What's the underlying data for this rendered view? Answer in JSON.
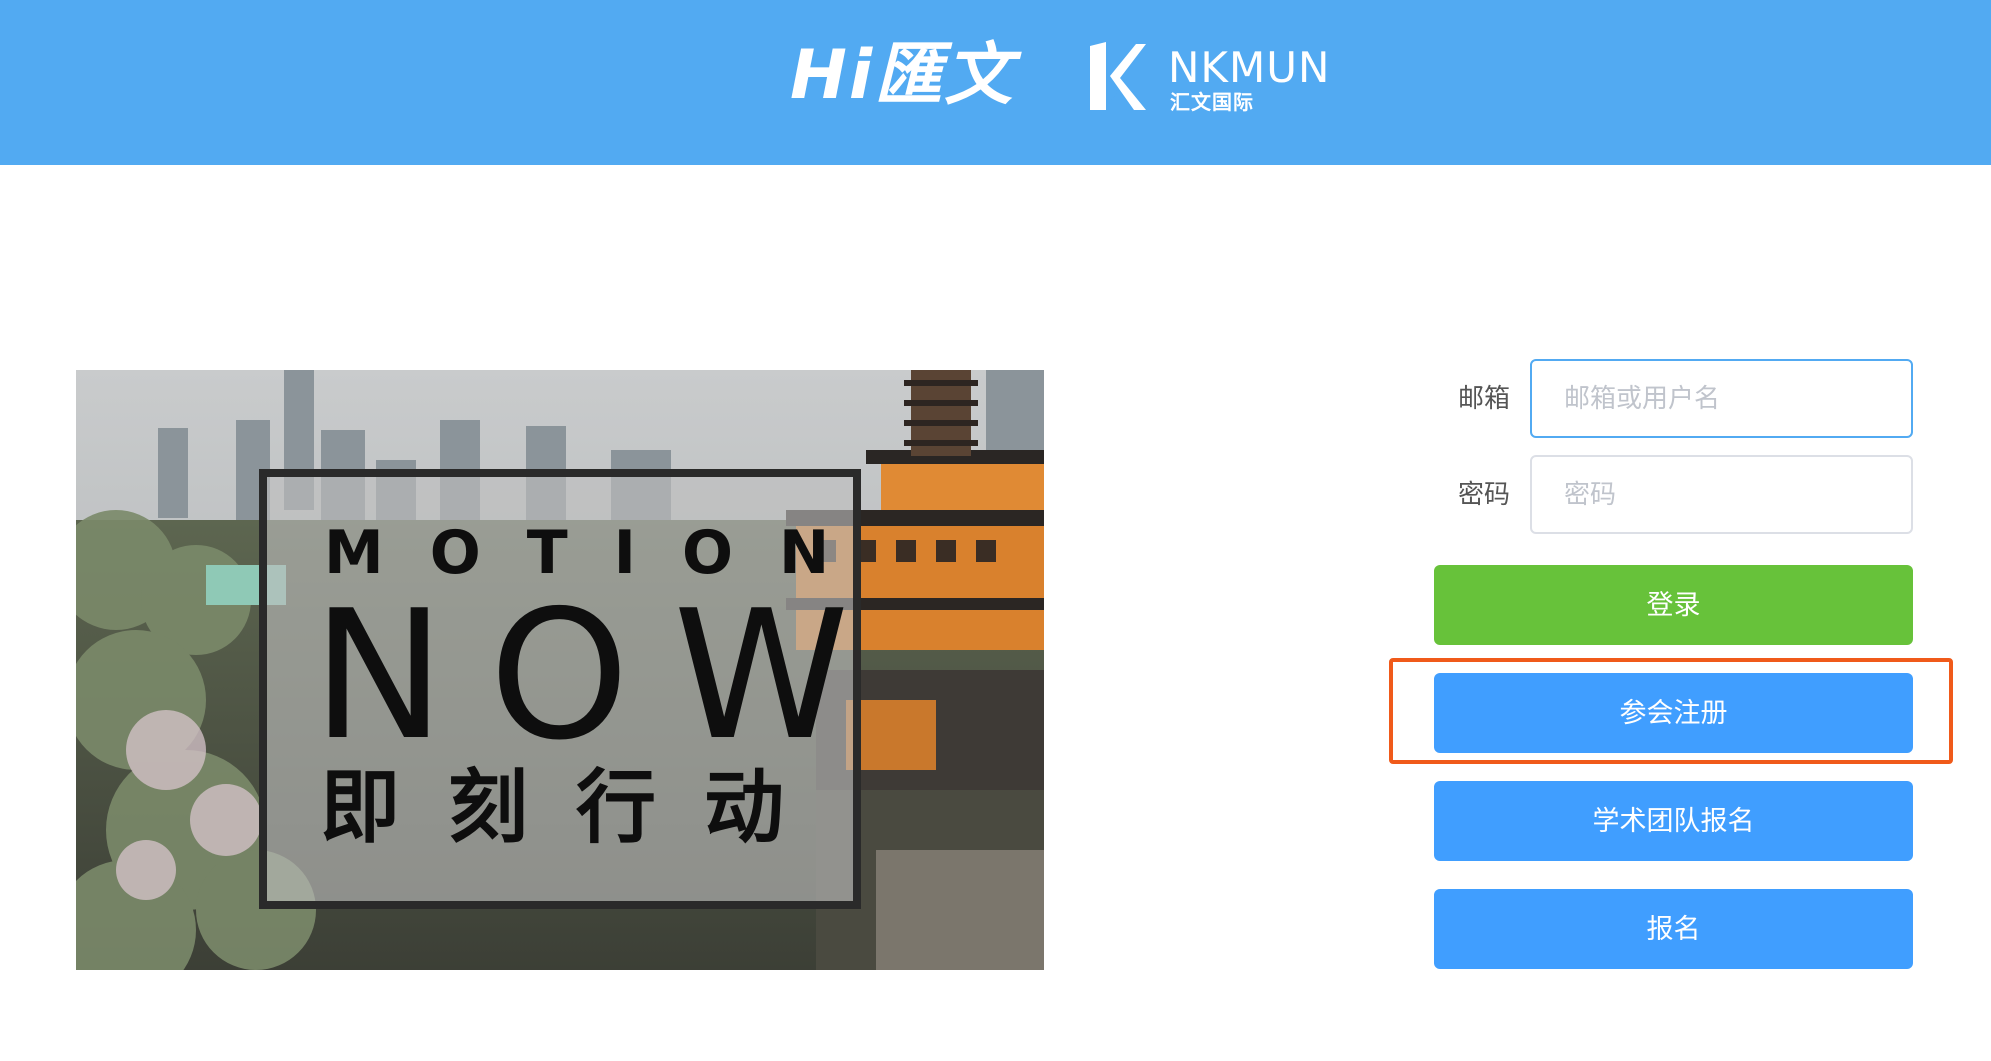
{
  "header": {
    "logo_hi": "Hi匯文",
    "logo_nk": "NKMUN",
    "logo_nk_sub": "汇文国际"
  },
  "banner": {
    "motion": "MOTION",
    "now": "NOW",
    "slogan_cn": "即刻行动"
  },
  "login": {
    "email_label": "邮箱",
    "email_placeholder": "邮箱或用户名",
    "email_value": "",
    "password_label": "密码",
    "password_placeholder": "密码",
    "password_value": "",
    "login_button": "登录",
    "register_button": "参会注册",
    "academic_button": "学术团队报名",
    "signup_button": "报名"
  },
  "colors": {
    "header_bg": "#52aaf2",
    "login_green": "#67c23a",
    "button_blue": "#409eff",
    "highlight_orange": "#f05a1a"
  }
}
